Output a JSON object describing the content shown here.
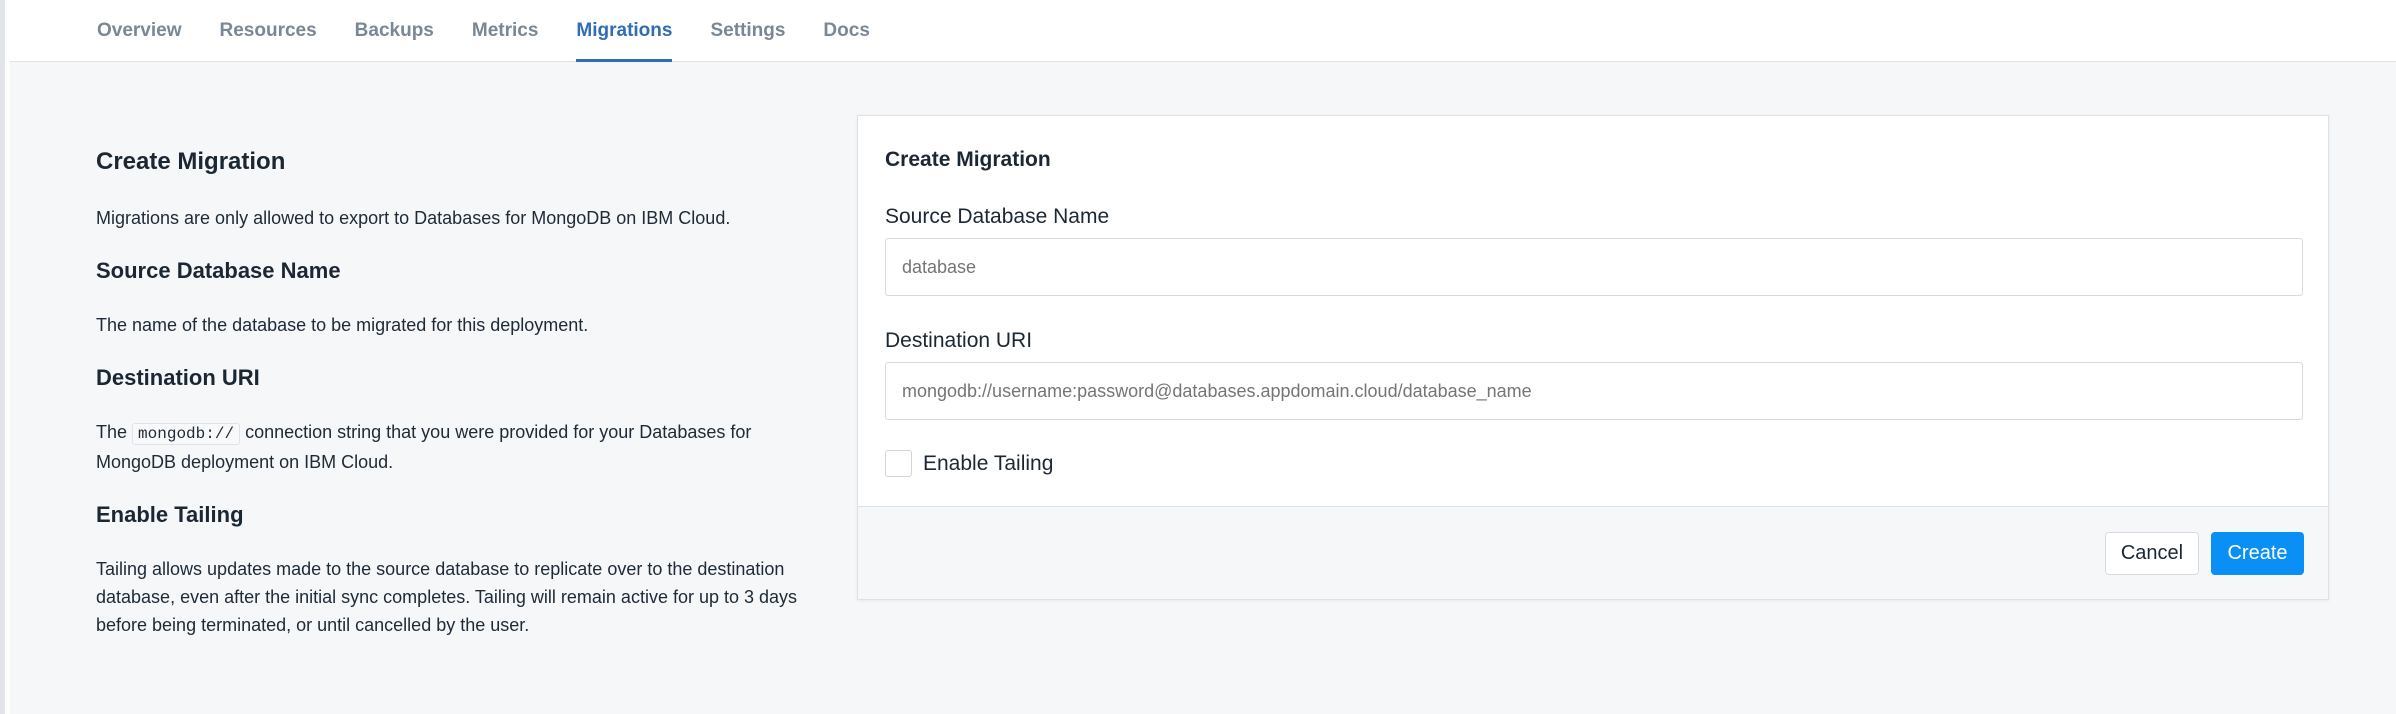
{
  "nav": {
    "tabs": [
      {
        "label": "Overview",
        "active": false
      },
      {
        "label": "Resources",
        "active": false
      },
      {
        "label": "Backups",
        "active": false
      },
      {
        "label": "Metrics",
        "active": false
      },
      {
        "label": "Migrations",
        "active": true
      },
      {
        "label": "Settings",
        "active": false
      },
      {
        "label": "Docs",
        "active": false
      }
    ],
    "active_color": "#2f6db5"
  },
  "info": {
    "title": "Create Migration",
    "intro": "Migrations are only allowed to export to Databases for MongoDB on IBM Cloud.",
    "source_heading": "Source Database Name",
    "source_text": "The name of the database to be migrated for this deployment.",
    "dest_heading": "Destination URI",
    "dest_text_before": "The",
    "dest_code": "mongodb://",
    "dest_text_after": "connection string that you were provided for your Databases for MongoDB deployment on IBM Cloud.",
    "tailing_heading": "Enable Tailing",
    "tailing_text": "Tailing allows updates made to the source database to replicate over to the destination database, even after the initial sync completes. Tailing will remain active for up to 3 days before being terminated, or until cancelled by the user."
  },
  "form": {
    "title": "Create Migration",
    "source_label": "Source Database Name",
    "source_placeholder": "database",
    "source_value": "",
    "dest_label": "Destination URI",
    "dest_placeholder": "mongodb://username:password@databases.appdomain.cloud/database_name",
    "dest_value": "",
    "tailing_label": "Enable Tailing",
    "tailing_checked": false,
    "cancel_label": "Cancel",
    "create_label": "Create",
    "primary_color": "#0a8ff5"
  }
}
